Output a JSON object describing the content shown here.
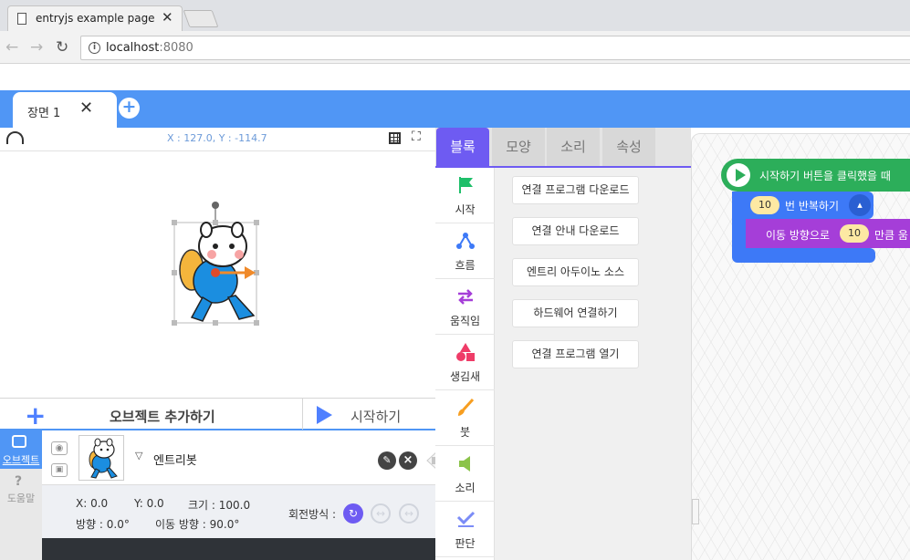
{
  "browser": {
    "tab_title": "entryjs example page",
    "tab_close": "✕",
    "url_host": "localhost",
    "url_port": ":8080"
  },
  "scene": {
    "tab_label": "장면 1",
    "close": "✕",
    "add": "+"
  },
  "stage": {
    "coordinates": "X : 127.0, Y : -114.7"
  },
  "object_bar": {
    "add_label": "오브젝트 추가하기",
    "add_plus": "+",
    "start_label": "시작하기"
  },
  "side_tabs": {
    "object": "오브젝트",
    "help_icon": "?",
    "help": "도움말"
  },
  "object": {
    "name": "엔트리봇",
    "caret": "▽",
    "x": "X: 0.0",
    "y": "Y: 0.0",
    "size": "크기 : 100.0",
    "direction": "방향 : 0.0°",
    "move_direction": "이동 방향 : 90.0°",
    "rotation_label": "회전방식 :"
  },
  "block_tabs": [
    "블록",
    "모양",
    "소리",
    "속성"
  ],
  "categories": [
    {
      "label": "시작",
      "icon": "flag-icon",
      "color": "#1fbf6a"
    },
    {
      "label": "흐름",
      "icon": "flow-icon",
      "color": "#3d79f7"
    },
    {
      "label": "움직임",
      "icon": "move-arrows-icon",
      "color": "#a53ed8"
    },
    {
      "label": "생김새",
      "icon": "shapes-icon",
      "color": "#ef3c68"
    },
    {
      "label": "붓",
      "icon": "brush-icon",
      "color": "#f79e20"
    },
    {
      "label": "소리",
      "icon": "speaker-icon",
      "color": "#8bc34a"
    },
    {
      "label": "판단",
      "icon": "check-icon",
      "color": "#7b8cf7"
    }
  ],
  "hardware_buttons": [
    "연결 프로그램 다운로드",
    "연결 안내 다운로드",
    "엔트리 아두이노 소스",
    "하드웨어 연결하기",
    "연결 프로그램 열기"
  ],
  "script": {
    "start_block": "시작하기 버튼을 클릭했을 때",
    "repeat_count": "10",
    "repeat_text": "번 반복하기",
    "move_text1": "이동 방향으로",
    "move_count": "10",
    "move_text2": "만큼 움"
  }
}
